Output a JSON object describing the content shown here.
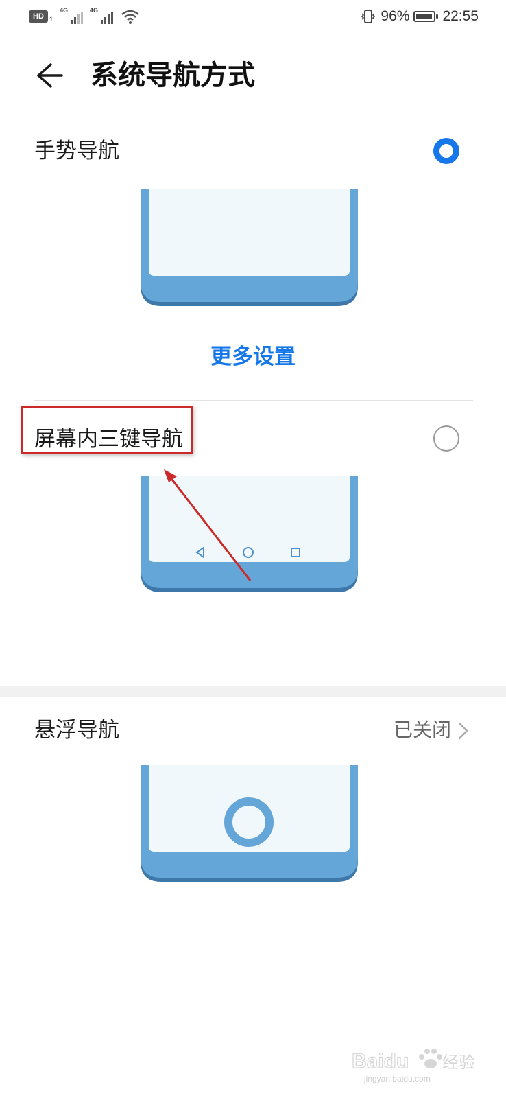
{
  "status_bar": {
    "hd_label": "HD",
    "sim_number": "1",
    "network_1": "4G",
    "network_2": "4G",
    "battery_percent": "96%",
    "battery_level": 0.96,
    "time": "22:55"
  },
  "header": {
    "title": "系统导航方式"
  },
  "options": {
    "gesture": {
      "label": "手势导航",
      "selected": true
    },
    "more_settings": "更多设置",
    "three_key": {
      "label": "屏幕内三键导航",
      "selected": false
    },
    "floating": {
      "label": "悬浮导航",
      "value": "已关闭"
    }
  },
  "watermark": {
    "brand": "Baidu",
    "cn": "经验",
    "url": "jingyan.baidu.com"
  },
  "colors": {
    "accent": "#1677e8",
    "phone_frame": "#64a6d8",
    "phone_frame_shadow": "#3e78ab",
    "phone_screen": "#f1f8fc",
    "annotation_red": "#cc2a2a"
  }
}
